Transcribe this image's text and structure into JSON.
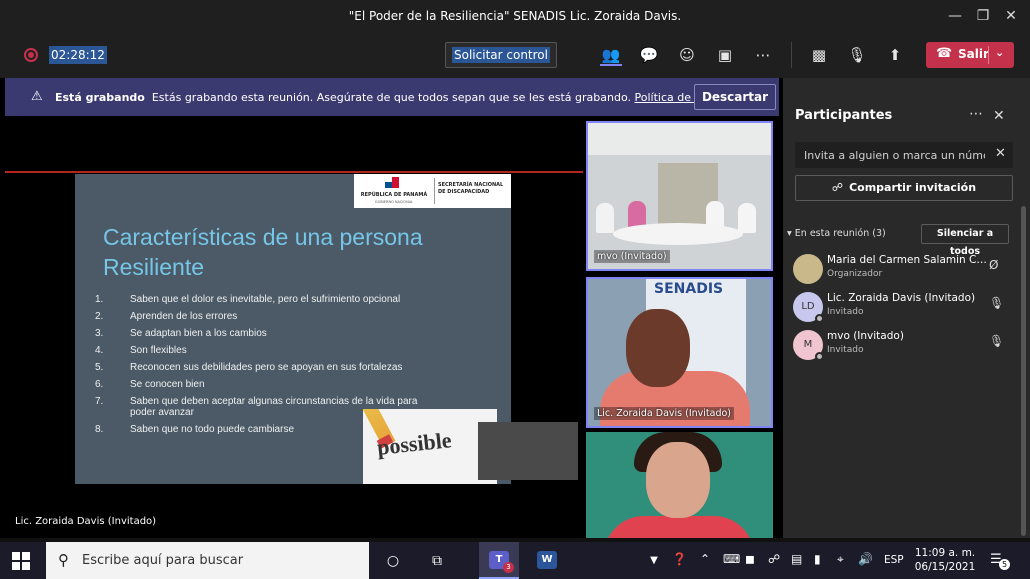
{
  "window": {
    "title": "\"El Poder de la Resiliencia\" SENADIS Lic. Zoraida Davis."
  },
  "toolbar": {
    "timer": "02:28:12",
    "request_control": "Solicitar control",
    "leave_label": "Salir"
  },
  "banner": {
    "bold": "Está grabando",
    "message": "Estás grabando esta reunión. Asegúrate de que todos sepan que se les está grabando.",
    "link": "Política de privacidad",
    "dismiss": "Descartar"
  },
  "slide": {
    "logo_left_line1": "REPÚBLICA DE PANAMÁ",
    "logo_left_line2": "GOBIERNO NACIONAL",
    "logo_right": "SECRETARÍA NACIONAL DE DISCAPACIDAD",
    "title_line1": "Características de una persona",
    "title_line2": "Resiliente",
    "items": [
      {
        "num": "1.",
        "text": "Saben que el dolor es inevitable, pero el sufrimiento opcional"
      },
      {
        "num": "2.",
        "text": "Aprenden de los errores"
      },
      {
        "num": "3.",
        "text": "Se adaptan bien a los cambios"
      },
      {
        "num": "4.",
        "text": "Son flexibles"
      },
      {
        "num": "5.",
        "text": "Reconocen sus debilidades pero se apoyan en sus fortalezas"
      },
      {
        "num": "6.",
        "text": "Se conocen bien"
      },
      {
        "num": "7.",
        "text": "Saben que deben aceptar algunas circunstancias de la vida para poder avanzar"
      },
      {
        "num": "8.",
        "text": "Saben que no todo puede cambiarse"
      }
    ],
    "picture_word": "possible"
  },
  "stage": {
    "presenter": "Lic. Zoraida Davis (Invitado)"
  },
  "videos": [
    {
      "name": "mvo (Invitado)"
    },
    {
      "name": "Lic. Zoraida Davis (Invitado)",
      "sign": "SENADIS"
    },
    {
      "name": ""
    }
  ],
  "panel": {
    "title": "Participantes",
    "invite_placeholder": "Invita a alguien o marca un número",
    "share": "Compartir invitación",
    "in_meeting": "En esta reunión (3)",
    "mute_all": "Silenciar a todos",
    "participants": [
      {
        "name": "Maria del Carmen Salamin Ca...",
        "role": "Organizador",
        "initials": "",
        "avatar_color": "#c9b98a"
      },
      {
        "name": "Lic. Zoraida Davis (Invitado)",
        "role": "Invitado",
        "initials": "LD",
        "avatar_color": "#c8c8ee"
      },
      {
        "name": "mvo (Invitado)",
        "role": "Invitado",
        "initials": "M",
        "avatar_color": "#f0c4d0"
      }
    ]
  },
  "taskbar": {
    "search_placeholder": "Escribe aquí para buscar",
    "teams_badge": "3",
    "language": "ESP",
    "time": "11:09 a. m.",
    "date": "06/15/2021",
    "notifications": "5"
  }
}
